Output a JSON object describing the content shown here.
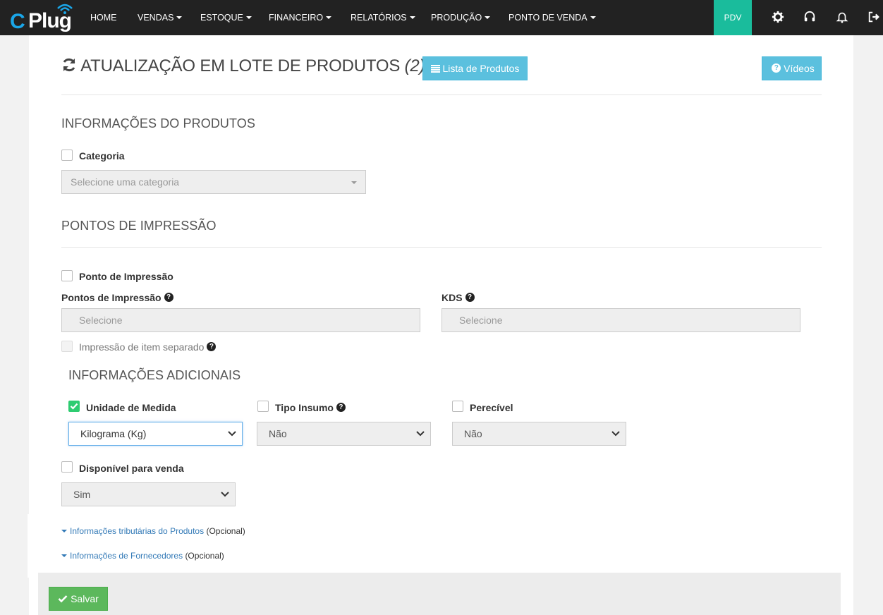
{
  "nav": {
    "logo_c": "C",
    "logo_plug": "Plug",
    "items": [
      "HOME",
      "VENDAS",
      "ESTOQUE",
      "FINANCEIRO",
      "RELATÓRIOS",
      "PRODUÇÃO",
      "PONTO DE VENDA"
    ],
    "pdv": "PDV",
    "icons": [
      "gear-icon",
      "headset-icon",
      "bell-icon",
      "logout-icon"
    ],
    "colors": {
      "bar": "#222222",
      "pdv": "#1abc9c",
      "logo_c": "#1aa6e8"
    }
  },
  "header": {
    "title": "ATUALIZAÇÃO EM LOTE DE PRODUTOS",
    "count": "(2)",
    "list_button": "Lista de Produtos",
    "videos_button": "Vídeos"
  },
  "produto": {
    "section_title": "INFORMAÇÕES DO PRODUTOS",
    "categoria_label": "Categoria",
    "categoria_checked": false,
    "categoria_placeholder": "Selecione uma categoria"
  },
  "impressao": {
    "section_title": "PONTOS DE IMPRESSÃO",
    "ponto_label": "Ponto de Impressão",
    "ponto_checked": false,
    "pontos_label": "Pontos de Impressão",
    "pontos_placeholder": "Selecione",
    "kds_label": "KDS",
    "kds_placeholder": "Selecione",
    "separado_label": "Impressão de item separado"
  },
  "adicionais": {
    "section_title": "INFORMAÇÕES ADICIONAIS",
    "unidade_label": "Unidade de Medida",
    "unidade_checked": true,
    "unidade_value": "Kilograma (Kg)",
    "tipo_label": "Tipo Insumo",
    "tipo_checked": false,
    "tipo_value": "Não",
    "perecivel_label": "Perecível",
    "perecivel_checked": false,
    "perecivel_value": "Não",
    "disponivel_label": "Disponível para venda",
    "disponivel_checked": false,
    "disponivel_value": "Sim"
  },
  "links": {
    "tributarias": "Informações tributárias do Produtos",
    "tributarias_opt": "(Opcional)",
    "fornecedores": "Informações de Fornecedores",
    "fornecedores_opt": "(Opcional)"
  },
  "footer": {
    "save_button": "Salvar",
    "save_color": "#5cb85c"
  }
}
